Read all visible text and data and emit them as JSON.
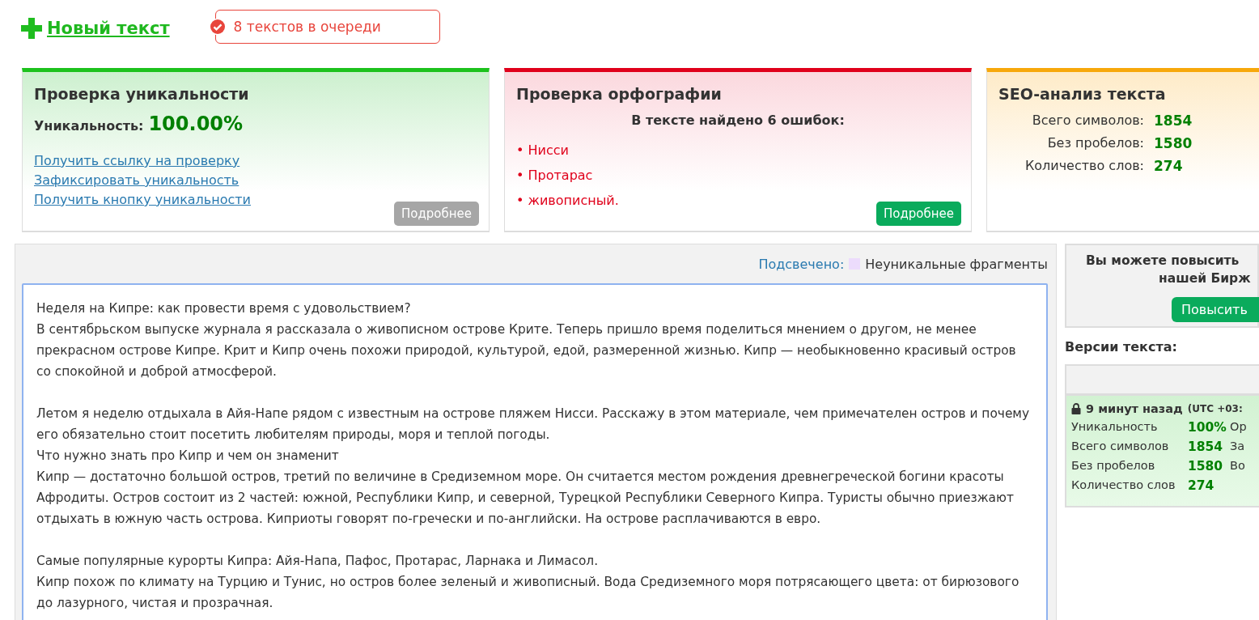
{
  "toolbar": {
    "new_text": "Новый текст",
    "queue": "8 текстов в очереди"
  },
  "cards": [
    {
      "kind": "uniqueness",
      "title": "Проверка уникальности",
      "label": "Уникальность:",
      "value": "100.00%",
      "links": [
        "Получить ссылку на проверку",
        "Зафиксировать уникальность",
        "Получить кнопку уникальности"
      ],
      "button": {
        "label": "Подробнее",
        "disabled": true
      }
    },
    {
      "kind": "spelling",
      "title": "Проверка орфографии",
      "summary": "В тексте найдено 6 ошибок:",
      "errors": [
        "• Нисси",
        "• Протарас",
        "• живописный."
      ],
      "button": {
        "label": "Подробнее",
        "disabled": false
      }
    },
    {
      "kind": "seo",
      "title": "SEO-анализ текста",
      "stats": [
        {
          "label": "Всего символов:",
          "value": "1854"
        },
        {
          "label": "Без пробелов:",
          "value": "1580"
        },
        {
          "label": "Количество слов:",
          "value": "274"
        }
      ]
    }
  ],
  "editor": {
    "legend_label": "Подсвечено:",
    "legend_text": "Неуникальные фрагменты",
    "blocks": [
      [
        "Неделя на Кипре: как провести время с удовольствием?",
        "В сентябрьском выпуске журнала я рассказала о живописном острове Крите. Теперь пришло время поделиться мнением о другом, не менее прекрасном острове Кипре. Крит и Кипр очень похожи природой, культурой, едой, размеренной жизнью. Кипр — необыкновенно красивый остров со спокойной и доброй атмосферой."
      ],
      [
        "Летом я неделю отдыхала в Айя-Напе рядом с известным на острове пляжем Нисси. Расскажу в этом материале, чем примечателен остров и почему его обязательно стоит посетить любителям природы, моря и теплой погоды.",
        "Что нужно знать про Кипр и чем он знаменит",
        "Кипр — достаточно большой остров, третий по величине в Средиземном море. Он считается местом рождения древнегреческой богини красоты Афродиты. Остров состоит из 2 частей: южной, Республики Кипр, и северной, Турецкой Республики Северного Кипра. Туристы обычно приезжают отдыхать в южную часть острова. Киприоты говорят по-гречески и по-английски. На острове расплачиваются в евро."
      ],
      [
        "Самые популярные курорты Кипра: Айя-Напа, Пафос, Протарас, Ларнака и Лимасол.",
        "Кипр похож по климату на Турцию и Тунис, но остров более зеленый и живописный. Вода Средиземного моря потрясающего цвета: от бирюзового до лазурного, чистая и прозрачная."
      ]
    ]
  },
  "promo": {
    "lines": [
      "Вы можете повысить",
      "нашей Бирж"
    ],
    "button": "Повысить"
  },
  "versions": {
    "title": "Версии текста:",
    "items": [
      {
        "time": "9 минут назад",
        "zone": "(UTC +03:",
        "locked": true,
        "stats": [
          {
            "label": "Уникальность",
            "value": "100%",
            "extra": "Ор"
          },
          {
            "label": "Всего символов",
            "value": "1854",
            "extra": "За"
          },
          {
            "label": "Без пробелов",
            "value": "1580",
            "extra": "Во"
          },
          {
            "label": "Количество слов",
            "value": "274"
          }
        ]
      }
    ]
  }
}
